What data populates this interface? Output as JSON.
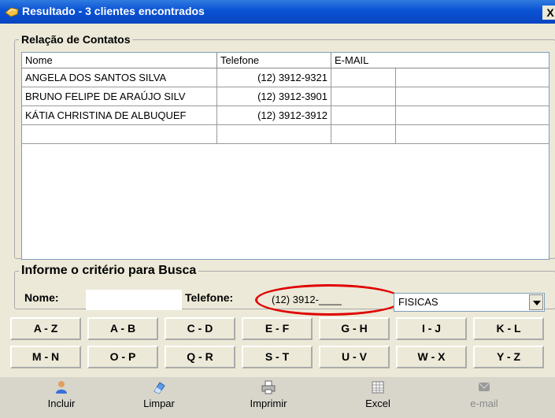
{
  "window": {
    "title": "Resultado - 3 clientes encontrados",
    "close_label": "X"
  },
  "contacts": {
    "legend": "Relação de Contatos",
    "columns": [
      "Nome",
      "Telefone",
      "E-MAIL"
    ],
    "rows": [
      {
        "nome": "ANGELA DOS SANTOS SILVA",
        "telefone": "(12) 3912-9321",
        "email": ""
      },
      {
        "nome": "BRUNO FELIPE DE ARAÚJO SILV",
        "telefone": "(12) 3912-3901",
        "email": ""
      },
      {
        "nome": "KÁTIA CHRISTINA DE ALBUQUEF",
        "telefone": "(12) 3912-3912",
        "email": ""
      },
      {
        "nome": "",
        "telefone": "",
        "email": ""
      }
    ]
  },
  "search": {
    "legend": "Informe o critério para Busca",
    "nome_label": "Nome:",
    "nome_value": "",
    "telefone_label": "Telefone:",
    "telefone_value": "(12) 3912-____",
    "tipo_value": "FISICAS"
  },
  "letters": [
    "A - Z",
    "A - B",
    "C - D",
    "E - F",
    "G - H",
    "I - J",
    "K - L",
    "M - N",
    "O - P",
    "Q - R",
    "S - T",
    "U - V",
    "W - X",
    "Y - Z"
  ],
  "toolbar": {
    "incluir": "Incluir",
    "limpar": "Limpar",
    "imprimir": "Imprimir",
    "excel": "Excel",
    "email": "e-mail"
  },
  "colors": {
    "title_bar": "#0a52d4",
    "window_bg": "#ece9d8",
    "highlight_oval": "#e00000"
  }
}
